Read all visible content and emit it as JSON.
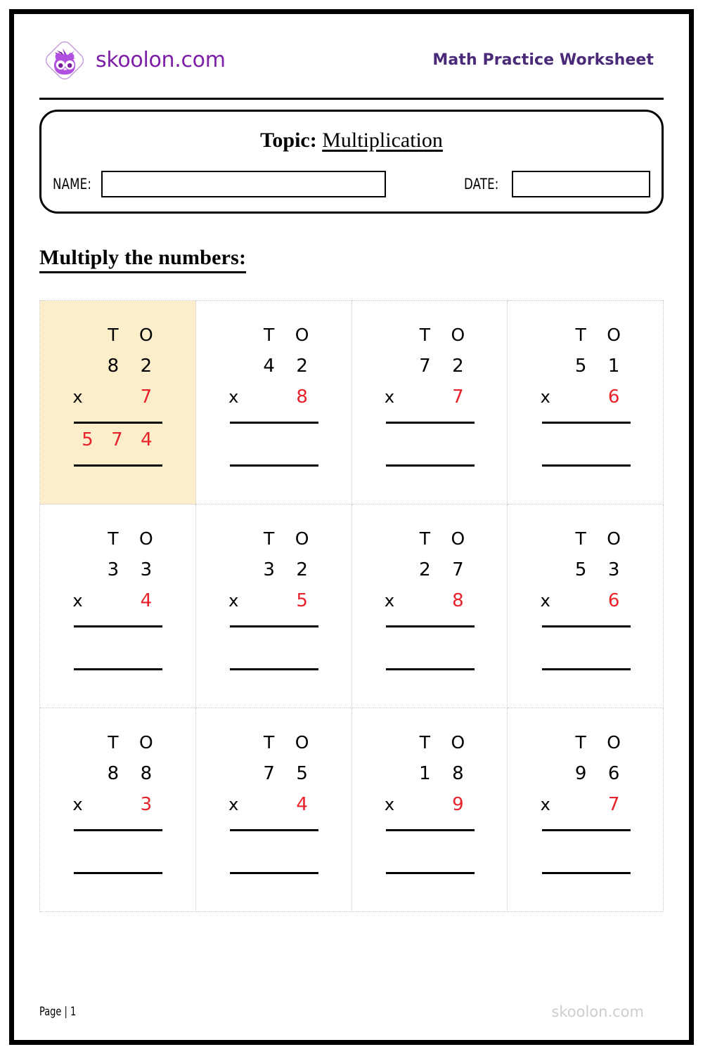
{
  "brand": {
    "logo_icon": "owl-diamond-logo",
    "name": "skoolon.com",
    "color": "#7d1fa6"
  },
  "header": {
    "title": "Math Practice Worksheet",
    "title_color": "#4a2a78"
  },
  "topic_card": {
    "topic_label": "Topic:",
    "topic_value": "Multiplication",
    "name_label": "NAME:",
    "name_value": "",
    "name_placeholder": "",
    "date_label": "DATE:",
    "date_value": "",
    "date_placeholder": ""
  },
  "instruction": "Multiply the numbers:",
  "columns": {
    "tens": "T",
    "ones": "O",
    "operator": "x"
  },
  "colors": {
    "answer_red": "#e8222a",
    "highlight": "#fceecb"
  },
  "problems": [
    {
      "tens": "8",
      "ones": "2",
      "multiplier": "7",
      "answer": [
        "5",
        "7",
        "4"
      ],
      "highlighted": true
    },
    {
      "tens": "4",
      "ones": "2",
      "multiplier": "8",
      "answer": [
        "",
        "",
        ""
      ],
      "highlighted": false
    },
    {
      "tens": "7",
      "ones": "2",
      "multiplier": "7",
      "answer": [
        "",
        "",
        ""
      ],
      "highlighted": false
    },
    {
      "tens": "5",
      "ones": "1",
      "multiplier": "6",
      "answer": [
        "",
        "",
        ""
      ],
      "highlighted": false
    },
    {
      "tens": "3",
      "ones": "3",
      "multiplier": "4",
      "answer": [
        "",
        "",
        ""
      ],
      "highlighted": false
    },
    {
      "tens": "3",
      "ones": "2",
      "multiplier": "5",
      "answer": [
        "",
        "",
        ""
      ],
      "highlighted": false
    },
    {
      "tens": "2",
      "ones": "7",
      "multiplier": "8",
      "answer": [
        "",
        "",
        ""
      ],
      "highlighted": false
    },
    {
      "tens": "5",
      "ones": "3",
      "multiplier": "6",
      "answer": [
        "",
        "",
        ""
      ],
      "highlighted": false
    },
    {
      "tens": "8",
      "ones": "8",
      "multiplier": "3",
      "answer": [
        "",
        "",
        ""
      ],
      "highlighted": false
    },
    {
      "tens": "7",
      "ones": "5",
      "multiplier": "4",
      "answer": [
        "",
        "",
        ""
      ],
      "highlighted": false
    },
    {
      "tens": "1",
      "ones": "8",
      "multiplier": "9",
      "answer": [
        "",
        "",
        ""
      ],
      "highlighted": false
    },
    {
      "tens": "9",
      "ones": "6",
      "multiplier": "7",
      "answer": [
        "",
        "",
        ""
      ],
      "highlighted": false
    }
  ],
  "footer": {
    "page": "Page | 1",
    "brand": "skoolon.com"
  }
}
